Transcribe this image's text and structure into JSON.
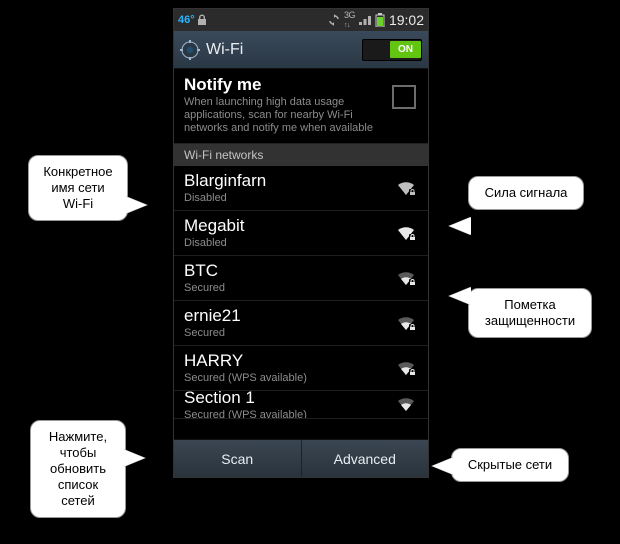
{
  "status": {
    "temp": "46°",
    "clock": "19:02",
    "net_label": "3G",
    "battery_pct": 85
  },
  "header": {
    "title": "Wi-Fi",
    "toggle_on_label": "ON"
  },
  "notify": {
    "title": "Notify me",
    "sub": "When launching high data usage applications, scan for nearby Wi-Fi networks and notify me when available"
  },
  "section_label": "Wi-Fi networks",
  "networks": [
    {
      "ssid": "Blarginfarn",
      "sub": "Disabled",
      "secured": true,
      "strength": 3
    },
    {
      "ssid": "Megabit",
      "sub": "Disabled",
      "secured": true,
      "strength": 4
    },
    {
      "ssid": "BTC",
      "sub": "Secured",
      "secured": true,
      "strength": 2
    },
    {
      "ssid": "ernie21",
      "sub": "Secured",
      "secured": true,
      "strength": 2
    },
    {
      "ssid": "HARRY",
      "sub": "Secured (WPS available)",
      "secured": true,
      "strength": 2
    },
    {
      "ssid": "Section 1",
      "sub": "Secured (WPS available)",
      "secured": false,
      "strength": 2
    }
  ],
  "bottom": {
    "scan": "Scan",
    "advanced": "Advanced"
  },
  "callouts": {
    "c1": "Конкретное\nимя сети\nWi-Fi",
    "c2": "Сила сигнала",
    "c3": "Пометка\nзащищенности",
    "c4": "Нажмите,\nчтобы\nобновить\nсписок\nсетей",
    "c5": "Скрытые сети"
  }
}
